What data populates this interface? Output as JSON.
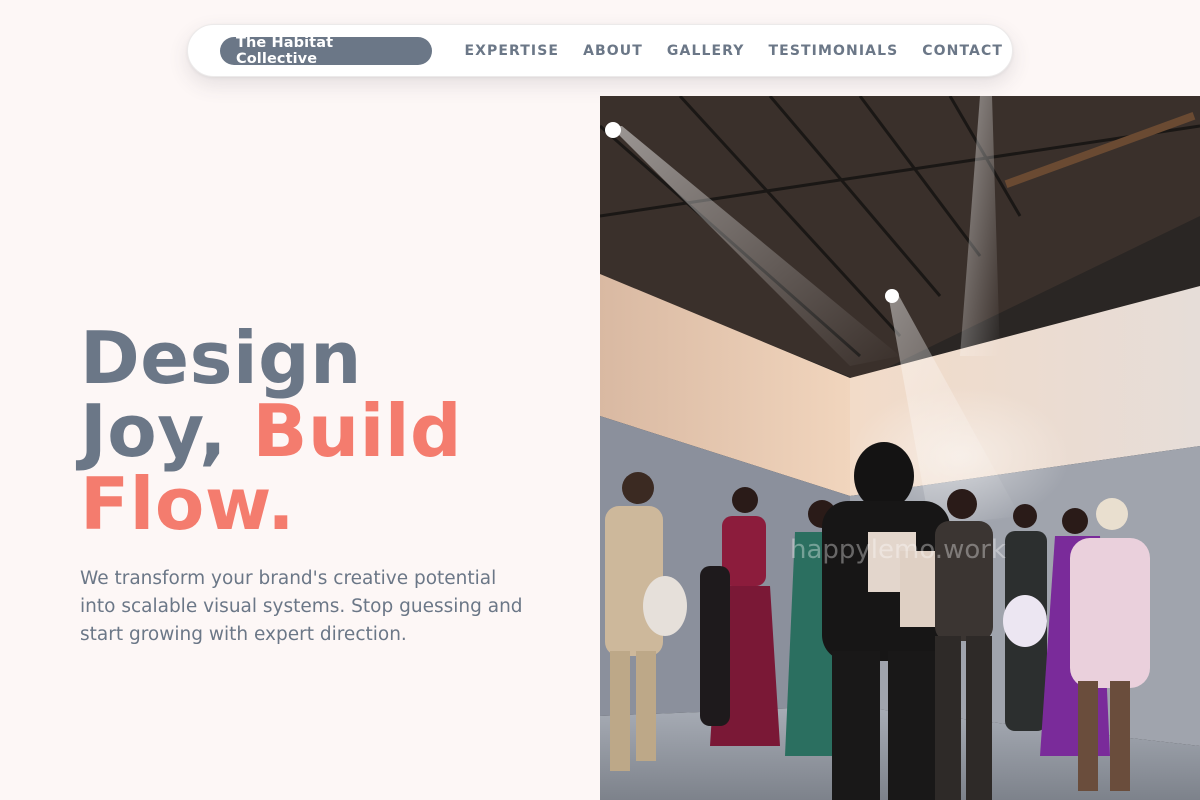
{
  "nav": {
    "brand": "The Habitat Collective",
    "links": [
      "EXPERTISE",
      "ABOUT",
      "GALLERY",
      "TESTIMONIALS",
      "CONTACT"
    ]
  },
  "hero": {
    "headline_part1": "Design",
    "headline_part2": "Joy, ",
    "headline_accent_a": "Build",
    "headline_accent_b": "Flow.",
    "subtitle": "We transform your brand's creative potential into scalable visual systems. Stop guessing and start growing with expert direction.",
    "image_watermark": "happylemo.work"
  },
  "colors": {
    "primary": "#6b7787",
    "accent": "#f47c6e",
    "background": "#fdf7f6"
  }
}
